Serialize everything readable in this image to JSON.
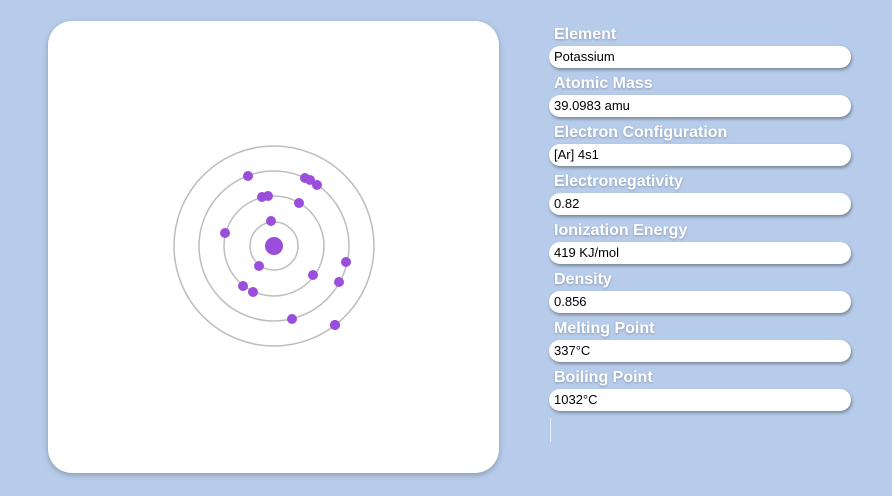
{
  "colors": {
    "background": "#b7ccea",
    "electron": "#9a4fdc",
    "orbit": "#bdbdbd",
    "nucleus": "#9a4fdc"
  },
  "atom": {
    "element": "Potassium",
    "shells": [
      2,
      8,
      8,
      1
    ]
  },
  "fields": [
    {
      "label": "Element",
      "value": "Potassium"
    },
    {
      "label": "Atomic Mass",
      "value": "39.0983 amu"
    },
    {
      "label": "Electron Configuration",
      "value": "[Ar] 4s1"
    },
    {
      "label": "Electronegativity",
      "value": "0.82"
    },
    {
      "label": "Ionization Energy",
      "value": "419 KJ/mol"
    },
    {
      "label": "Density",
      "value": "0.856"
    },
    {
      "label": "Melting Point",
      "value": "337°C"
    },
    {
      "label": "Boiling Point",
      "value": "1032°C"
    }
  ]
}
